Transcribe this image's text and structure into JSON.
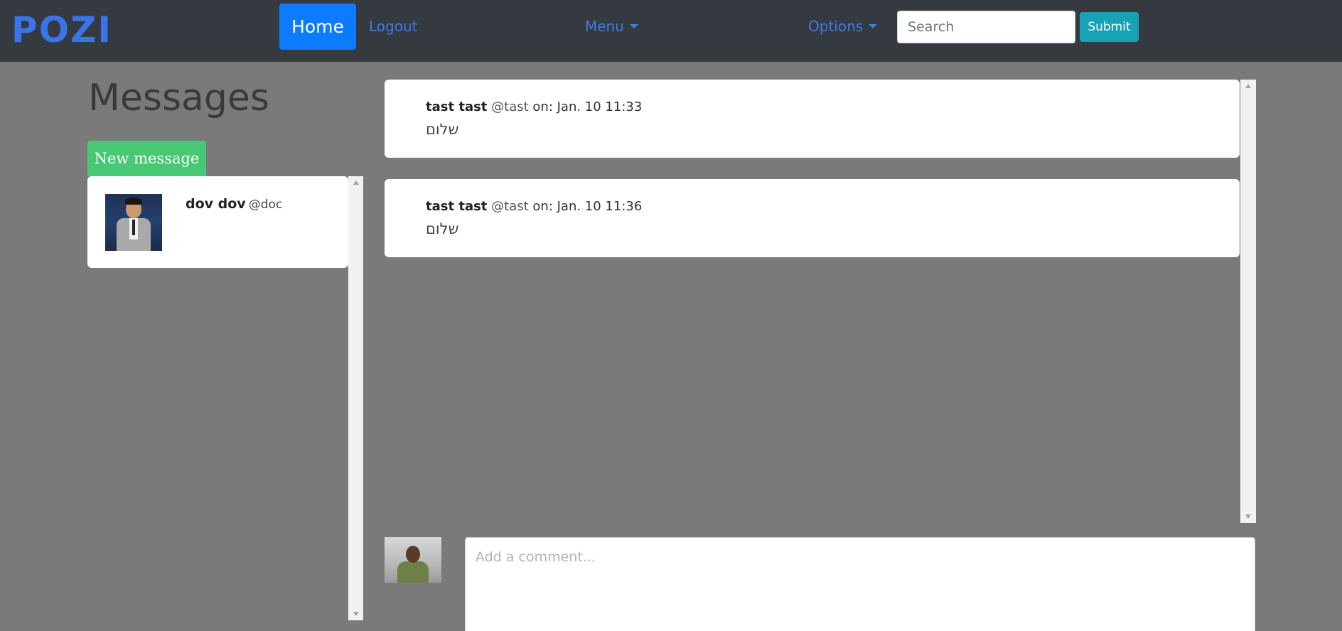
{
  "navbar": {
    "brand": "POZI",
    "home_label": "Home",
    "logout_label": "Logout",
    "menu_label": "Menu",
    "options_label": "Options",
    "search_placeholder": "Search",
    "submit_label": "Submit"
  },
  "sidebar": {
    "title": "Messages",
    "new_message_label": "New message",
    "conversations": [
      {
        "name": "dov dov",
        "handle": "@doc"
      }
    ]
  },
  "messages": [
    {
      "name": "tast tast",
      "handle": "@tast",
      "timestamp": "on: Jan. 10 11:33",
      "text": "שלום"
    },
    {
      "name": "tast tast",
      "handle": "@tast",
      "timestamp": "on: Jan. 10 11:36",
      "text": "שלום"
    }
  ],
  "comment": {
    "placeholder": "Add a comment..."
  },
  "colors": {
    "navbar_bg": "#343a40",
    "brand": "#3b73e8",
    "home_button": "#0d7bff",
    "submit_button": "#17a2b8",
    "new_message_button": "#48c774",
    "page_bg": "#7a7a7a"
  }
}
